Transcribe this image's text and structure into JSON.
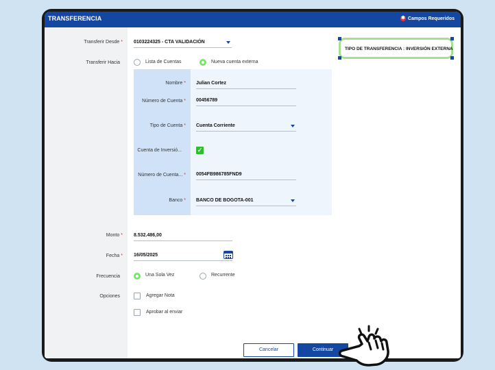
{
  "header": {
    "title": "TRANSFERENCIA",
    "required_label": "Campos Requeridos"
  },
  "form": {
    "desde": {
      "label": "Transferir Desde",
      "value": "0103224325 - CTA VALIDACIÓN"
    },
    "hacia": {
      "label": "Transferir Hacia",
      "options": [
        "Lista de Cuentas",
        "Nueva cuenta externa"
      ],
      "selected": 1
    },
    "tipo_transferencia": "TIPO DE TRANSFERENCIA : INVERSIÓN EXTERNA",
    "externa": {
      "nombre": {
        "label": "Nombre",
        "value": "Julian Cortez"
      },
      "numero": {
        "label": "Número de Cuenta",
        "value": "00456789"
      },
      "tipo": {
        "label": "Tipo de Cuenta",
        "value": "Cuenta Corriente"
      },
      "inversion": {
        "label": "Cuenta de Inversió...",
        "checked": true
      },
      "numero2": {
        "label": "Número de Cuenta...",
        "value": "0054FB986785FND9"
      },
      "banco": {
        "label": "Banco",
        "value": "BANCO DE BOGOTA-001"
      }
    },
    "monto": {
      "label": "Monto",
      "value": "8.532.486,00"
    },
    "fecha": {
      "label": "Fecha",
      "value": "16/05/2025"
    },
    "frecuencia": {
      "label": "Frecuencia",
      "options": [
        "Una Sola Vez",
        "Recurrente"
      ],
      "selected": 0
    },
    "opciones": {
      "label": "Opciones",
      "items": [
        "Agregar Nota",
        "Aprobar al enviar"
      ]
    }
  },
  "buttons": {
    "cancel": "Cancelar",
    "continue": "Continuar"
  },
  "colors": {
    "primary": "#1447a2",
    "required": "#d93025",
    "selected": "#7ce36e",
    "checkbox": "#2ebd2e"
  }
}
